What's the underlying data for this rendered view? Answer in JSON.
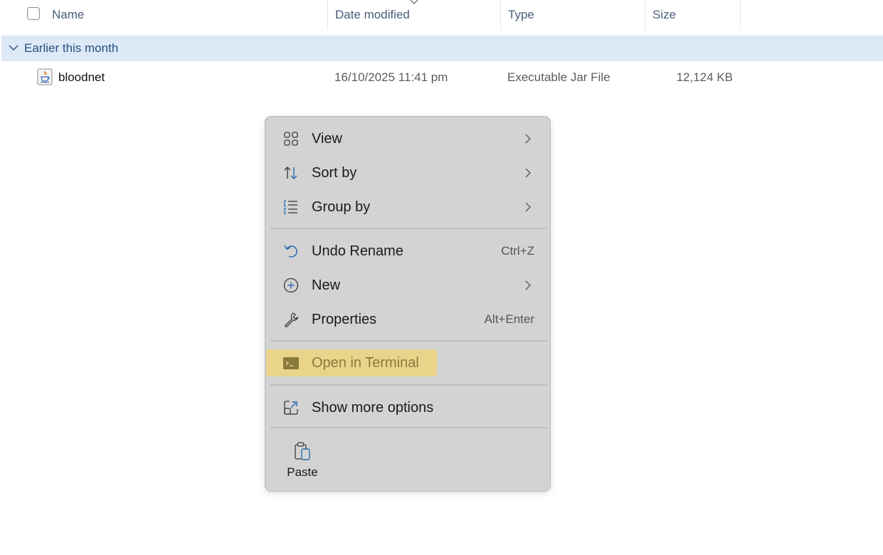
{
  "columns": {
    "name": "Name",
    "date": "Date modified",
    "type": "Type",
    "size": "Size"
  },
  "group": {
    "label": "Earlier this month"
  },
  "files": [
    {
      "name": "bloodnet",
      "date_modified": "16/10/2025 11:41 pm",
      "type": "Executable Jar File",
      "size": "12,124 KB",
      "icon": "java-jar-icon"
    }
  ],
  "context_menu": {
    "items": [
      {
        "label": "View",
        "icon": "view-grid-icon",
        "submenu": true
      },
      {
        "label": "Sort by",
        "icon": "sort-icon",
        "submenu": true
      },
      {
        "label": "Group by",
        "icon": "group-list-icon",
        "submenu": true
      },
      {
        "label": "Undo Rename",
        "icon": "undo-icon",
        "shortcut": "Ctrl+Z"
      },
      {
        "label": "New",
        "icon": "plus-circle-icon",
        "submenu": true
      },
      {
        "label": "Properties",
        "icon": "wrench-icon",
        "shortcut": "Alt+Enter"
      },
      {
        "label": "Open in Terminal",
        "icon": "terminal-icon",
        "highlighted": true
      },
      {
        "label": "Show more options",
        "icon": "expand-icon"
      }
    ],
    "quick_actions": [
      {
        "label": "Paste",
        "icon": "paste-icon"
      }
    ]
  },
  "colors": {
    "group_background": "#dde9f7",
    "menu_background": "#d3d3d3",
    "highlight": "#e9d48a",
    "accent_blue": "#2b6cb0"
  }
}
